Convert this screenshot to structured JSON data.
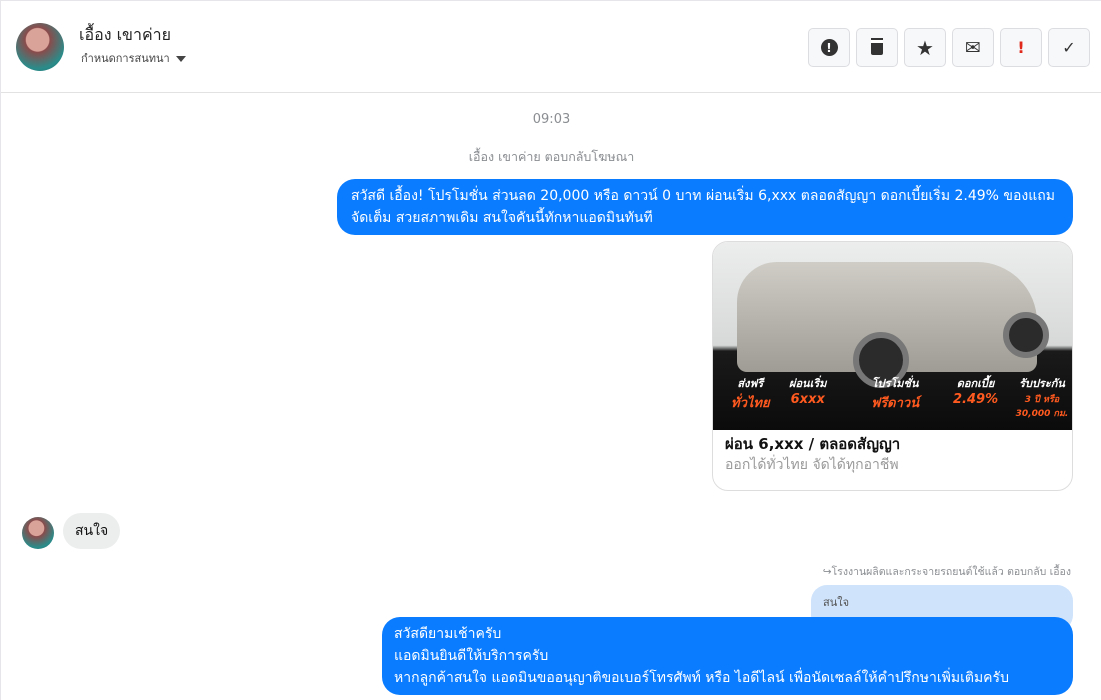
{
  "header": {
    "name": "เอื้อง เขาค่าย",
    "subtitle": "กำหนดการสนทนา",
    "tools": [
      {
        "icon": "alert-circle-icon",
        "glyph": "❗"
      },
      {
        "icon": "trash-icon",
        "glyph": "🗑"
      },
      {
        "icon": "star-icon",
        "glyph": "★"
      },
      {
        "icon": "envelope-icon",
        "glyph": "✉"
      },
      {
        "icon": "exclamation-icon",
        "glyph": "!"
      },
      {
        "icon": "check-icon",
        "glyph": "✓"
      }
    ]
  },
  "thread": {
    "time": "09:03",
    "ad_note": "เอื้อง เขาค่าย ตอบกลับโฆษณา",
    "ad_message": "สวัสดี เอื้อง! โปรโมชั่น ส่วนลด 20,000 หรือ ดาวน์ 0 บาท ผ่อนเริ่ม 6,xxx ตลอดสัญญา ดอกเบี้ยเริ่ม 2.49% ของแถมจัดเต็ม สวยสภาพเดิม สนใจคันนี้ทักหาแอดมินทันที",
    "card": {
      "title": "ผ่อน 6,xxx / ตลอดสัญญา",
      "subtitle": "ออกได้ทั่วไทย จัดได้ทุกอาชีพ",
      "promos": [
        {
          "t": "ส่งฟรี",
          "v": "ทั่วไทย"
        },
        {
          "t": "ผ่อนเริ่ม",
          "v": "6xxx"
        },
        {
          "t": "โปรโมชั่น",
          "v": "ฟรีดาวน์"
        },
        {
          "t": "ดอกเบี้ย",
          "v": "2.49%"
        },
        {
          "t": "รับประกัน",
          "v": "3 ปี หรือ 30,000 กม."
        }
      ]
    },
    "incoming": "สนใจ",
    "reply_header": "โรงงานผลิตและกระจายรถยนต์ใช้แล้ว ตอบกลับ เอื้อง",
    "quoted": "สนใจ",
    "reply_lines": [
      "สวัสดียามเช้าครับ",
      "แอดมินยินดีให้บริการครับ",
      "หากลูกค้าสนใจ แอดมินขออนุญาติขอเบอร์โทรศัพท์ หรือ ไอดีไลน์ เพื่อนัดเซลล์ให้คำปรึกษาเพิ่มเติมครับ"
    ]
  }
}
